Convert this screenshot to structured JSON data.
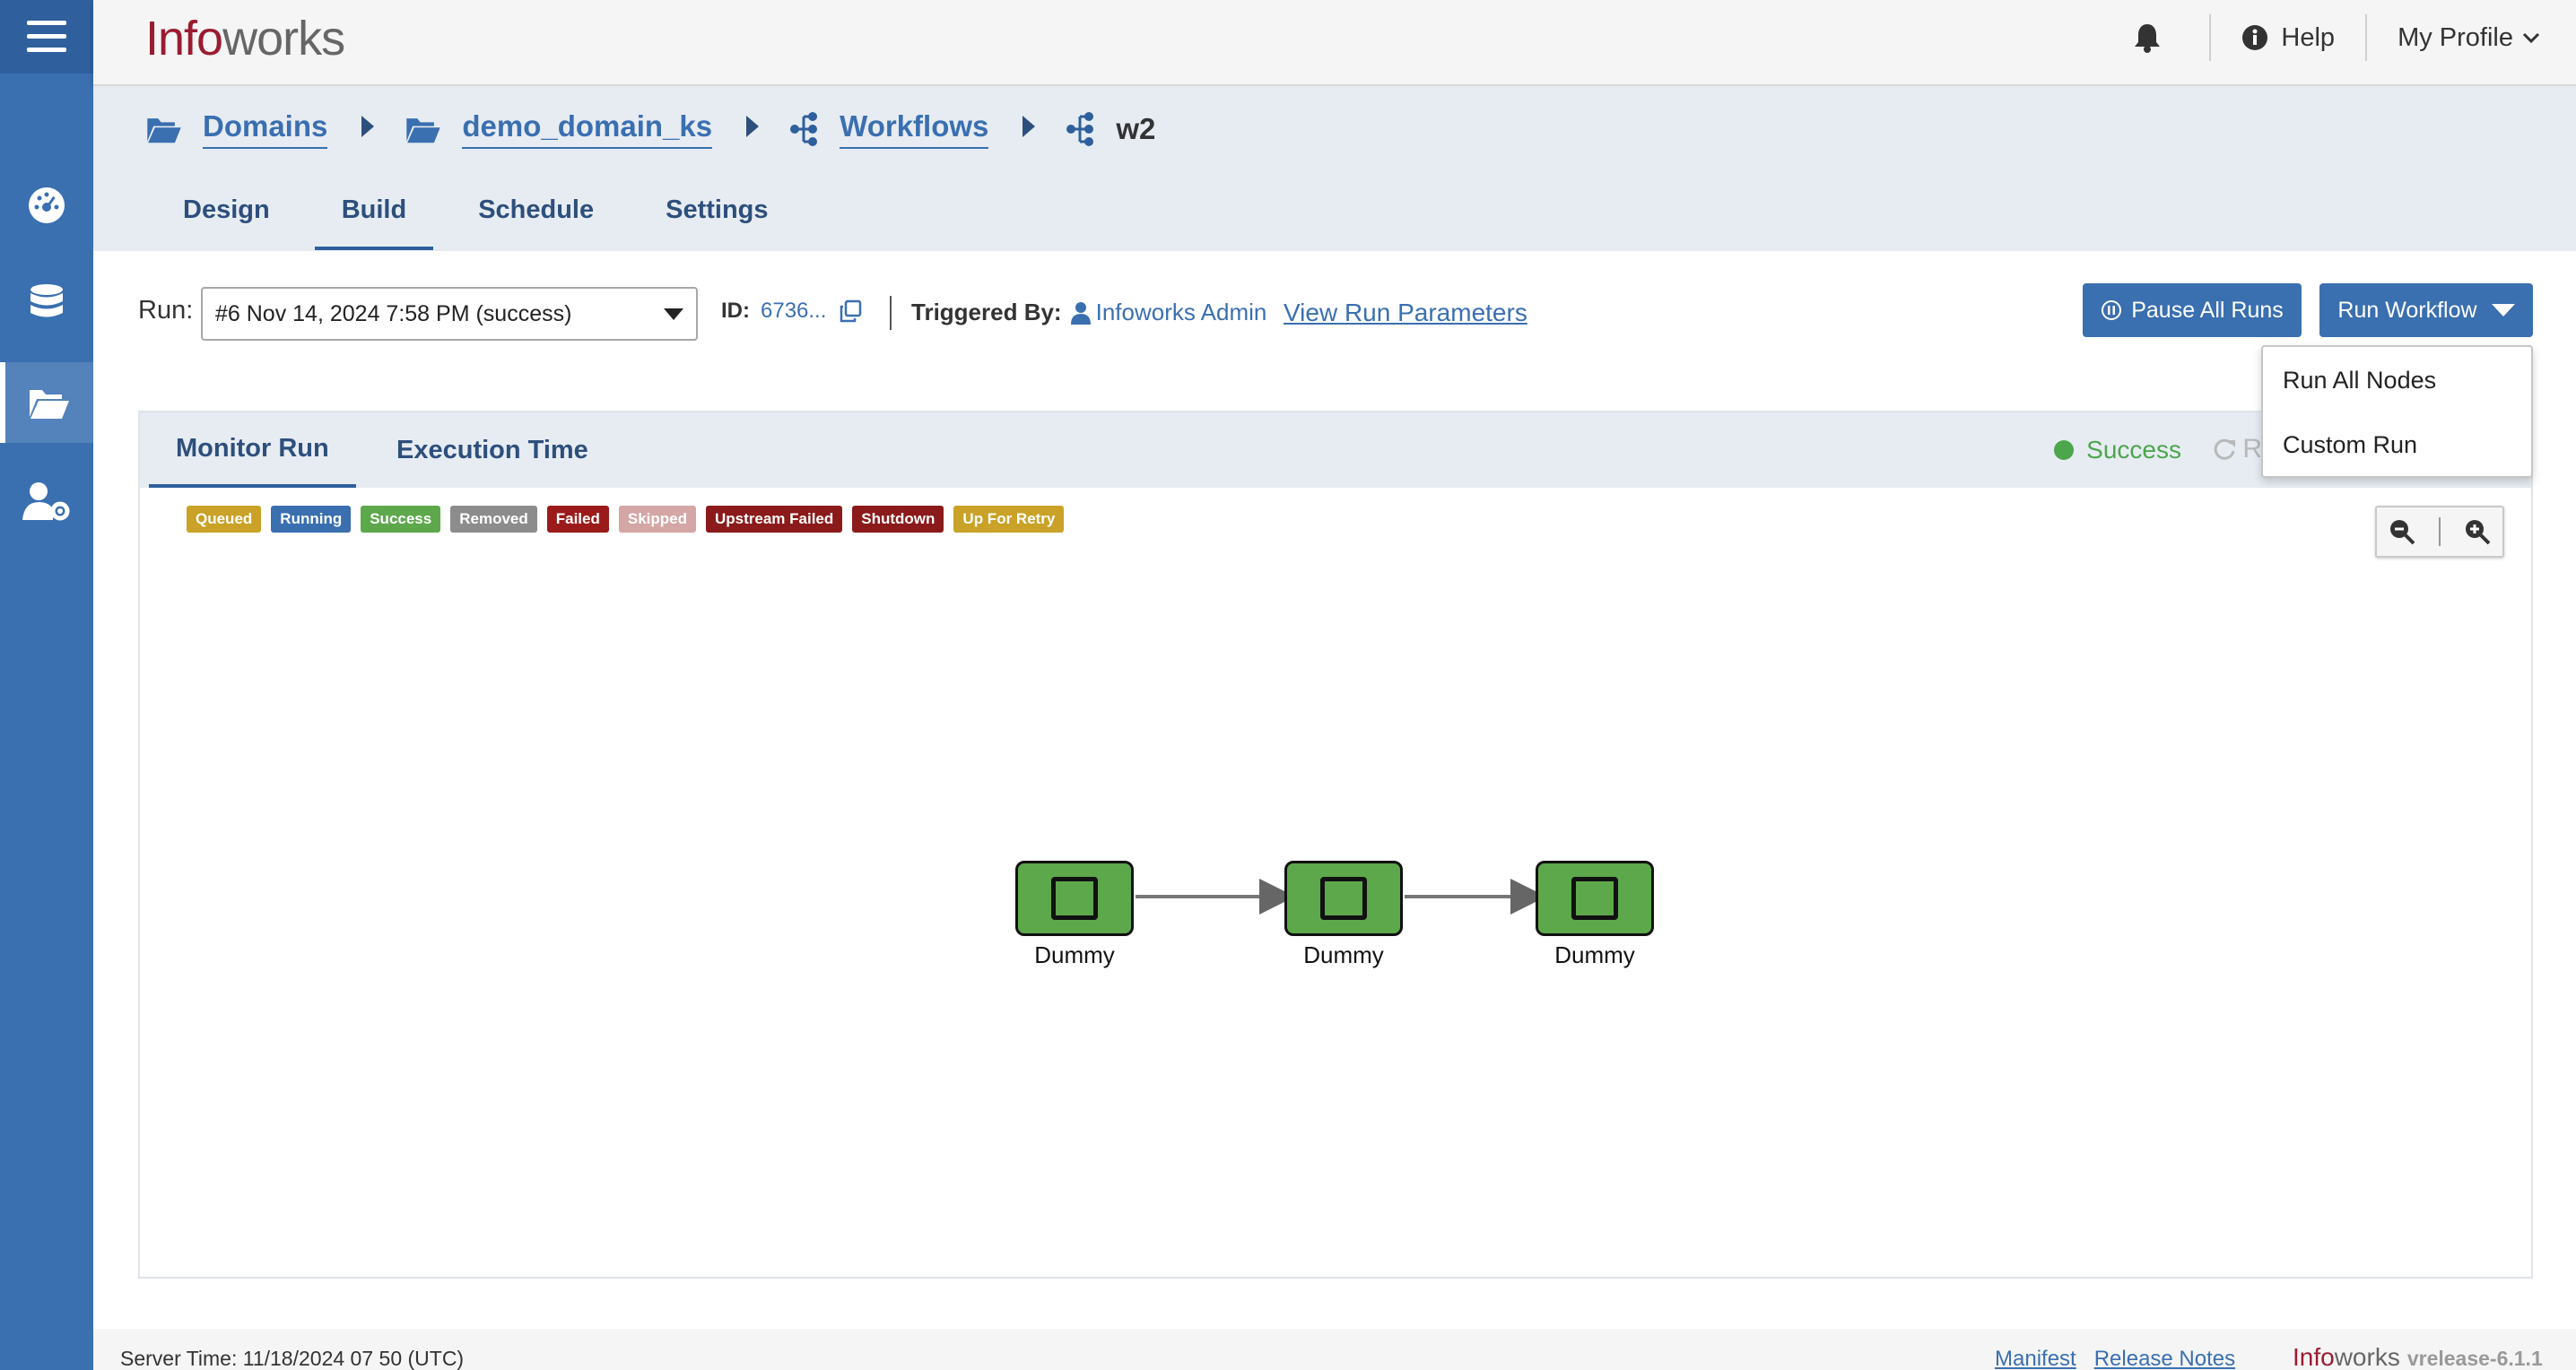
{
  "app": {
    "logo_info": "Info",
    "logo_works": "works"
  },
  "header": {
    "help_label": "Help",
    "profile_label": "My Profile"
  },
  "sidebar": {
    "items": [
      {
        "name": "menu-icon"
      },
      {
        "name": "dashboard-icon"
      },
      {
        "name": "database-icon"
      },
      {
        "name": "folder-open-icon",
        "active": true
      },
      {
        "name": "user-settings-icon"
      }
    ]
  },
  "breadcrumb": {
    "items": [
      {
        "label": "Domains",
        "icon": "folder-open-icon",
        "link": true
      },
      {
        "label": "demo_domain_ks",
        "icon": "folder-open-icon",
        "link": true
      },
      {
        "label": "Workflows",
        "icon": "workflow-icon",
        "link": true
      },
      {
        "label": "w2",
        "icon": "workflow-icon",
        "link": false
      }
    ]
  },
  "tabs": [
    "Design",
    "Build",
    "Schedule",
    "Settings"
  ],
  "active_tab": "Build",
  "run": {
    "label": "Run:",
    "selected": "#6 Nov 14, 2024 7:58 PM (success)",
    "id_label": "ID:",
    "id_value": "6736...",
    "triggered_label": "Triggered By:",
    "triggered_value": "Infoworks Admin",
    "view_params": "View Run Parameters"
  },
  "buttons": {
    "pause_all": "Pause All Runs",
    "run_workflow": "Run Workflow"
  },
  "run_menu": {
    "items": [
      "Run All Nodes",
      "Custom Run"
    ]
  },
  "panel": {
    "tabs": [
      "Monitor Run",
      "Execution Time"
    ],
    "active_tab": "Monitor Run",
    "status": "Success",
    "status_color": "#4ca64c",
    "refresh_partial": "R"
  },
  "legend": [
    {
      "label": "Queued",
      "color": "#c9a227"
    },
    {
      "label": "Running",
      "color": "#3a6fb0"
    },
    {
      "label": "Success",
      "color": "#5ea84c"
    },
    {
      "label": "Removed",
      "color": "#8c8c8c"
    },
    {
      "label": "Failed",
      "color": "#9b1b1b"
    },
    {
      "label": "Skipped",
      "color": "#d4a6a6"
    },
    {
      "label": "Upstream Failed",
      "color": "#8b1a1a"
    },
    {
      "label": "Shutdown",
      "color": "#8b1a1a"
    },
    {
      "label": "Up For Retry",
      "color": "#c9a227"
    }
  ],
  "graph": {
    "nodes": [
      {
        "label": "Dummy",
        "state": "Success"
      },
      {
        "label": "Dummy",
        "state": "Success"
      },
      {
        "label": "Dummy",
        "state": "Success"
      }
    ]
  },
  "footer": {
    "server_time": "Server Time: 11/18/2024 07 50 (UTC)",
    "links": [
      "Manifest",
      "Release Notes"
    ],
    "brand_info": "Info",
    "brand_works": "works",
    "version": "vrelease-6.1.1"
  }
}
